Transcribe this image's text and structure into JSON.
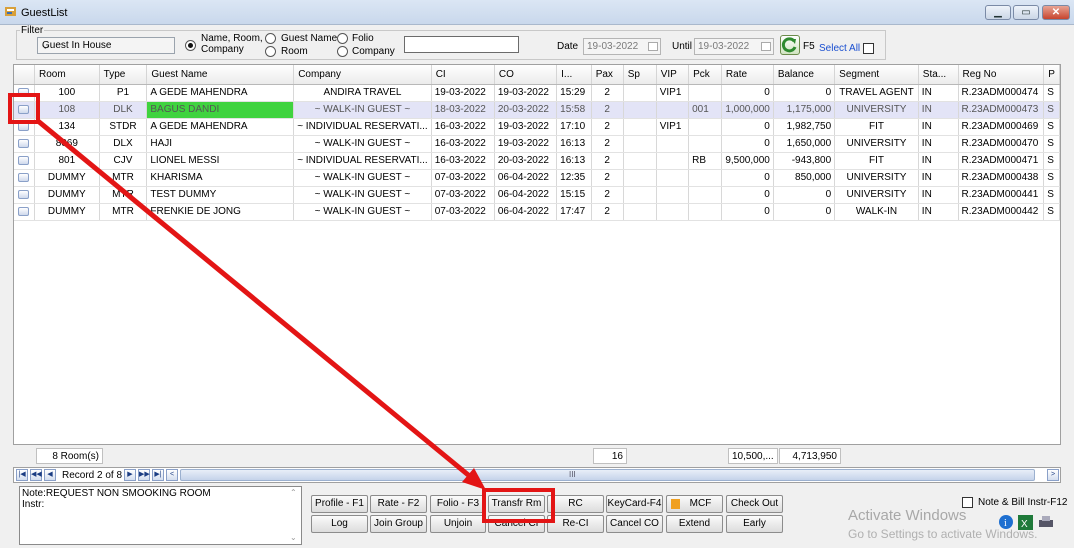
{
  "window": {
    "title": "GuestList",
    "min": "▁",
    "max": "▭",
    "close": "✕"
  },
  "filter": {
    "label": "Filter",
    "selected": "Guest In House",
    "radios": [
      "Name, Room,",
      "Company",
      "Guest Name",
      "Room",
      "Folio",
      "Company"
    ],
    "date_label": "Date",
    "date_value": "19-03-2022",
    "until_label": "Until",
    "until_value": "19-03-2022",
    "f5": "F5",
    "select_all": "Select All"
  },
  "table": {
    "columns": [
      "Room",
      "Type",
      "Guest Name",
      "Company",
      "CI",
      "CO",
      "I...",
      "Pax",
      "Sp",
      "VIP",
      "Pck",
      "Rate",
      "Balance",
      "Segment",
      "Sta...",
      "Reg No",
      "P"
    ],
    "rows": [
      [
        "100",
        "P1",
        "A GEDE MAHENDRA",
        "ANDIRA TRAVEL",
        "19-03-2022",
        "19-03-2022",
        "15:29",
        "2",
        "",
        "VIP1",
        "",
        "0",
        "0",
        "TRAVEL AGENT",
        "IN",
        "R.23ADM000474",
        "S"
      ],
      [
        "108",
        "DLK",
        "BAGUS DANDI",
        "~ WALK-IN GUEST ~",
        "18-03-2022",
        "20-03-2022",
        "15:58",
        "2",
        "",
        "",
        "001",
        "1,000,000",
        "1,175,000",
        "UNIVERSITY",
        "IN",
        "R.23ADM000473",
        "S"
      ],
      [
        "134",
        "STDR",
        "A GEDE MAHENDRA",
        "~ INDIVIDUAL RESERVATI...",
        "16-03-2022",
        "19-03-2022",
        "17:10",
        "2",
        "",
        "VIP1",
        "",
        "0",
        "1,982,750",
        "FIT",
        "IN",
        "R.23ADM000469",
        "S"
      ],
      [
        "8069",
        "DLX",
        "HAJI",
        "~ WALK-IN GUEST ~",
        "16-03-2022",
        "19-03-2022",
        "16:13",
        "2",
        "",
        "",
        "",
        "0",
        "1,650,000",
        "UNIVERSITY",
        "IN",
        "R.23ADM000470",
        "S"
      ],
      [
        "801",
        "CJV",
        "LIONEL MESSI",
        "~ INDIVIDUAL RESERVATI...",
        "16-03-2022",
        "20-03-2022",
        "16:13",
        "2",
        "",
        "",
        "RB",
        "9,500,000",
        "-943,800",
        "FIT",
        "IN",
        "R.23ADM000471",
        "S"
      ],
      [
        "DUMMY",
        "MTR",
        "KHARISMA",
        "~ WALK-IN GUEST ~",
        "07-03-2022",
        "06-04-2022",
        "12:35",
        "2",
        "",
        "",
        "",
        "0",
        "850,000",
        "UNIVERSITY",
        "IN",
        "R.23ADM000438",
        "S"
      ],
      [
        "DUMMY",
        "MTR",
        "TEST DUMMY",
        "~ WALK-IN GUEST ~",
        "07-03-2022",
        "06-04-2022",
        "15:15",
        "2",
        "",
        "",
        "",
        "0",
        "0",
        "UNIVERSITY",
        "IN",
        "R.23ADM000441",
        "S"
      ],
      [
        "DUMMY",
        "MTR",
        "FRENKIE DE JONG",
        "~ WALK-IN GUEST ~",
        "07-03-2022",
        "06-04-2022",
        "17:47",
        "2",
        "",
        "",
        "",
        "0",
        "0",
        "WALK-IN",
        "IN",
        "R.23ADM000442",
        "S"
      ]
    ]
  },
  "footer": {
    "rooms": "8 Room(s)",
    "pax": "16",
    "rate": "10,500,...",
    "balance": "4,713,950"
  },
  "nav": {
    "record": "Record 2 of 8",
    "scroll": "III"
  },
  "note": {
    "line1": "Note:REQUEST NON SMOOKING ROOM",
    "line2": "Instr:"
  },
  "buttons": {
    "profile": "Profile - F1",
    "rate": "Rate - F2",
    "folio": "Folio - F3",
    "transfr": "Transfr Rm",
    "rc": "RC",
    "keycard": "KeyCard-F4",
    "mcf": "MCF",
    "checkout": "Check Out",
    "log": "Log",
    "join": "Join Group",
    "unjoin": "Unjoin",
    "cancelci": "Cancel CI",
    "reci": "Re-CI",
    "cancelco": "Cancel CO",
    "extend": "Extend",
    "early": "Early"
  },
  "note_bill": "Note & Bill Instr-F12",
  "watermark": {
    "line1": "Activate Windows",
    "line2": "Go to Settings to activate Windows."
  }
}
